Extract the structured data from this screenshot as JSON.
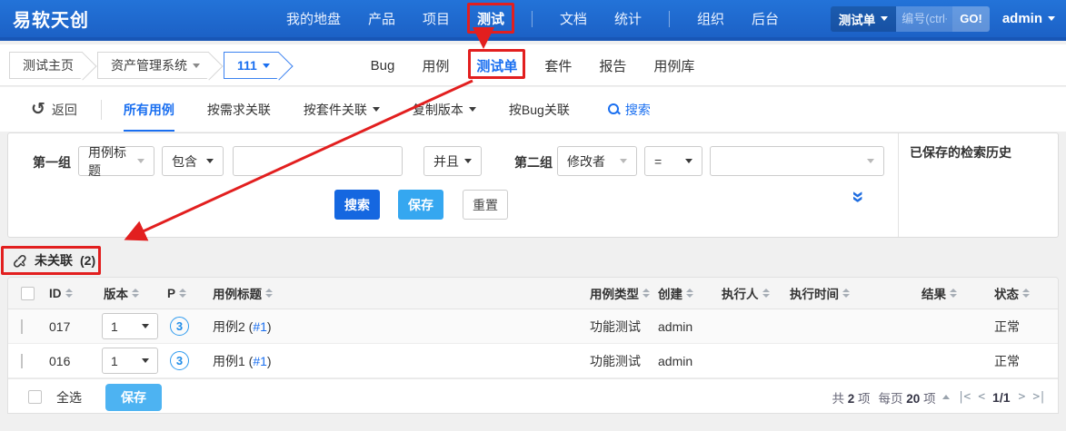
{
  "brand": "易软天创",
  "navbar": {
    "items": [
      "我的地盘",
      "产品",
      "项目",
      "测试",
      "文档",
      "统计",
      "组织",
      "后台"
    ],
    "active_item": "测试",
    "search_scope": "测试单",
    "search_placeholder": "编号(ctrl+",
    "go_label": "GO!",
    "user": "admin"
  },
  "breadcrumb": {
    "home": "测试主页",
    "product": "资产管理系统",
    "build": "111"
  },
  "tabs": {
    "items": [
      "Bug",
      "用例",
      "测试单",
      "套件",
      "报告",
      "用例库"
    ],
    "active": "测试单"
  },
  "toolbar": {
    "back_icon": "↺",
    "back": "返回",
    "menu": [
      "所有用例",
      "按需求关联",
      "按套件关联",
      "复制版本",
      "按Bug关联"
    ],
    "active": "所有用例",
    "search_label": "搜索"
  },
  "search_form": {
    "group1_label": "第一组",
    "field1": "用例标题",
    "op1": "包含",
    "value1": "",
    "joiner": "并且",
    "group2_label": "第二组",
    "field2": "修改者",
    "op2": "=",
    "value2": "",
    "search_btn": "搜索",
    "save_btn": "保存",
    "reset_btn": "重置",
    "collapse_icon": "»",
    "history_title": "已保存的检索历史"
  },
  "section": {
    "unlink_title": "未关联",
    "count": "(2)"
  },
  "table": {
    "headers": {
      "id": "ID",
      "version": "版本",
      "pri": "P",
      "title": "用例标题",
      "type": "用例类型",
      "creator": "创建",
      "executor": "执行人",
      "exec_time": "执行时间",
      "result": "结果",
      "status": "状态"
    },
    "rows": [
      {
        "id": "017",
        "version": "1",
        "pri": "3",
        "title": "用例2 (",
        "link": "#1",
        "close": ")",
        "type": "功能测试",
        "creator": "admin",
        "executor": "",
        "exec_time": "",
        "result": "",
        "status": "正常"
      },
      {
        "id": "016",
        "version": "1",
        "pri": "3",
        "title": "用例1 (",
        "link": "#1",
        "close": ")",
        "type": "功能测试",
        "creator": "admin",
        "executor": "",
        "exec_time": "",
        "result": "",
        "status": "正常"
      }
    ],
    "footer": {
      "select_all": "全选",
      "save_btn": "保存",
      "total_label": "共",
      "total_value": "2",
      "total_unit": "项",
      "perpage_label": "每页",
      "perpage_value": "20",
      "perpage_unit": "项",
      "page": "1/1",
      "first": "|<",
      "prev": "<",
      "next": ">",
      "last": ">|"
    }
  },
  "colors": {
    "navbar": "#1e66cc",
    "link": "#1a6ff0",
    "primary_btn": "#1567e0",
    "light_btn": "#35a7f0",
    "annotation": "#e21f1f"
  }
}
